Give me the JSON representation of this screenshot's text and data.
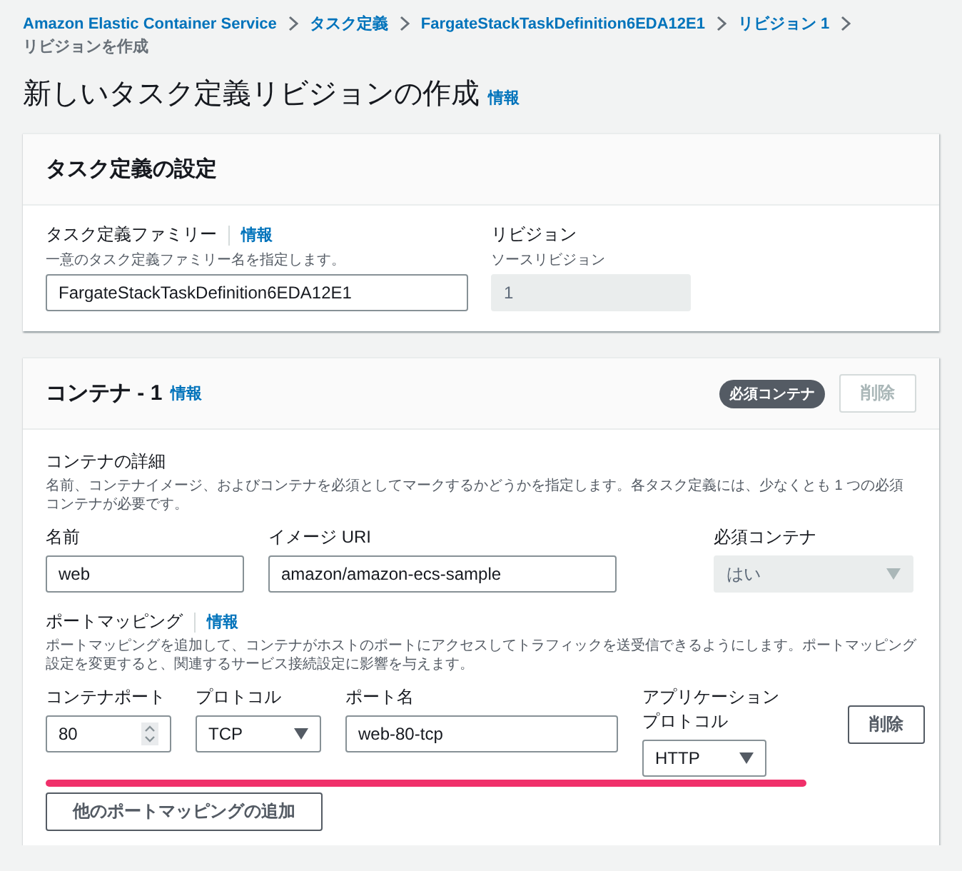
{
  "breadcrumb": {
    "links": [
      "Amazon Elastic Container Service",
      "タスク定義",
      "FargateStackTaskDefinition6EDA12E1",
      "リビジョン 1"
    ],
    "current": "リビジョンを作成"
  },
  "page": {
    "title": "新しいタスク定義リビジョンの作成",
    "info": "情報"
  },
  "task_definition": {
    "heading": "タスク定義の設定",
    "family": {
      "label": "タスク定義ファミリー",
      "info": "情報",
      "description": "一意のタスク定義ファミリー名を指定します。",
      "value": "FargateStackTaskDefinition6EDA12E1",
      "disabled": false
    },
    "revision": {
      "label": "リビジョン",
      "description": "ソースリビジョン",
      "value": "1",
      "disabled": true
    }
  },
  "container": {
    "heading": "コンテナ - 1",
    "info": "情報",
    "badge": "必須コンテナ",
    "remove_button": {
      "label": "削除",
      "disabled": true
    },
    "details": {
      "heading": "コンテナの詳細",
      "description": "名前、コンテナイメージ、およびコンテナを必須としてマークするかどうかを指定します。各タスク定義には、少なくとも 1 つの必須コンテナが必要です。",
      "fields": [
        {
          "label": "名前",
          "value": "web",
          "kind": "text",
          "disabled": false
        },
        {
          "label": "イメージ URI",
          "value": "amazon/amazon-ecs-sample",
          "kind": "text",
          "disabled": false
        },
        {
          "label": "必須コンテナ",
          "value": "はい",
          "kind": "select",
          "disabled": true
        }
      ]
    },
    "port_mappings": {
      "heading": "ポートマッピング",
      "info": "情報",
      "description": "ポートマッピングを追加して、コンテナがホストのポートにアクセスしてトラフィックを送受信できるようにします。ポートマッピング設定を変更すると、関連するサービス接続設定に影響を与えます。",
      "fields": [
        {
          "label": "コンテナポート",
          "value": "80",
          "kind": "number",
          "disabled": false
        },
        {
          "label": "プロトコル",
          "value": "TCP",
          "kind": "select",
          "disabled": false
        },
        {
          "label": "ポート名",
          "value": "web-80-tcp",
          "kind": "text",
          "disabled": false
        },
        {
          "label": "アプリケーションプロトコル",
          "value": "HTTP",
          "kind": "select",
          "disabled": false
        }
      ],
      "remove_button": {
        "label": "削除",
        "disabled": false
      },
      "add_button": "他のポートマッピングの追加",
      "highlight_underline": true
    }
  }
}
